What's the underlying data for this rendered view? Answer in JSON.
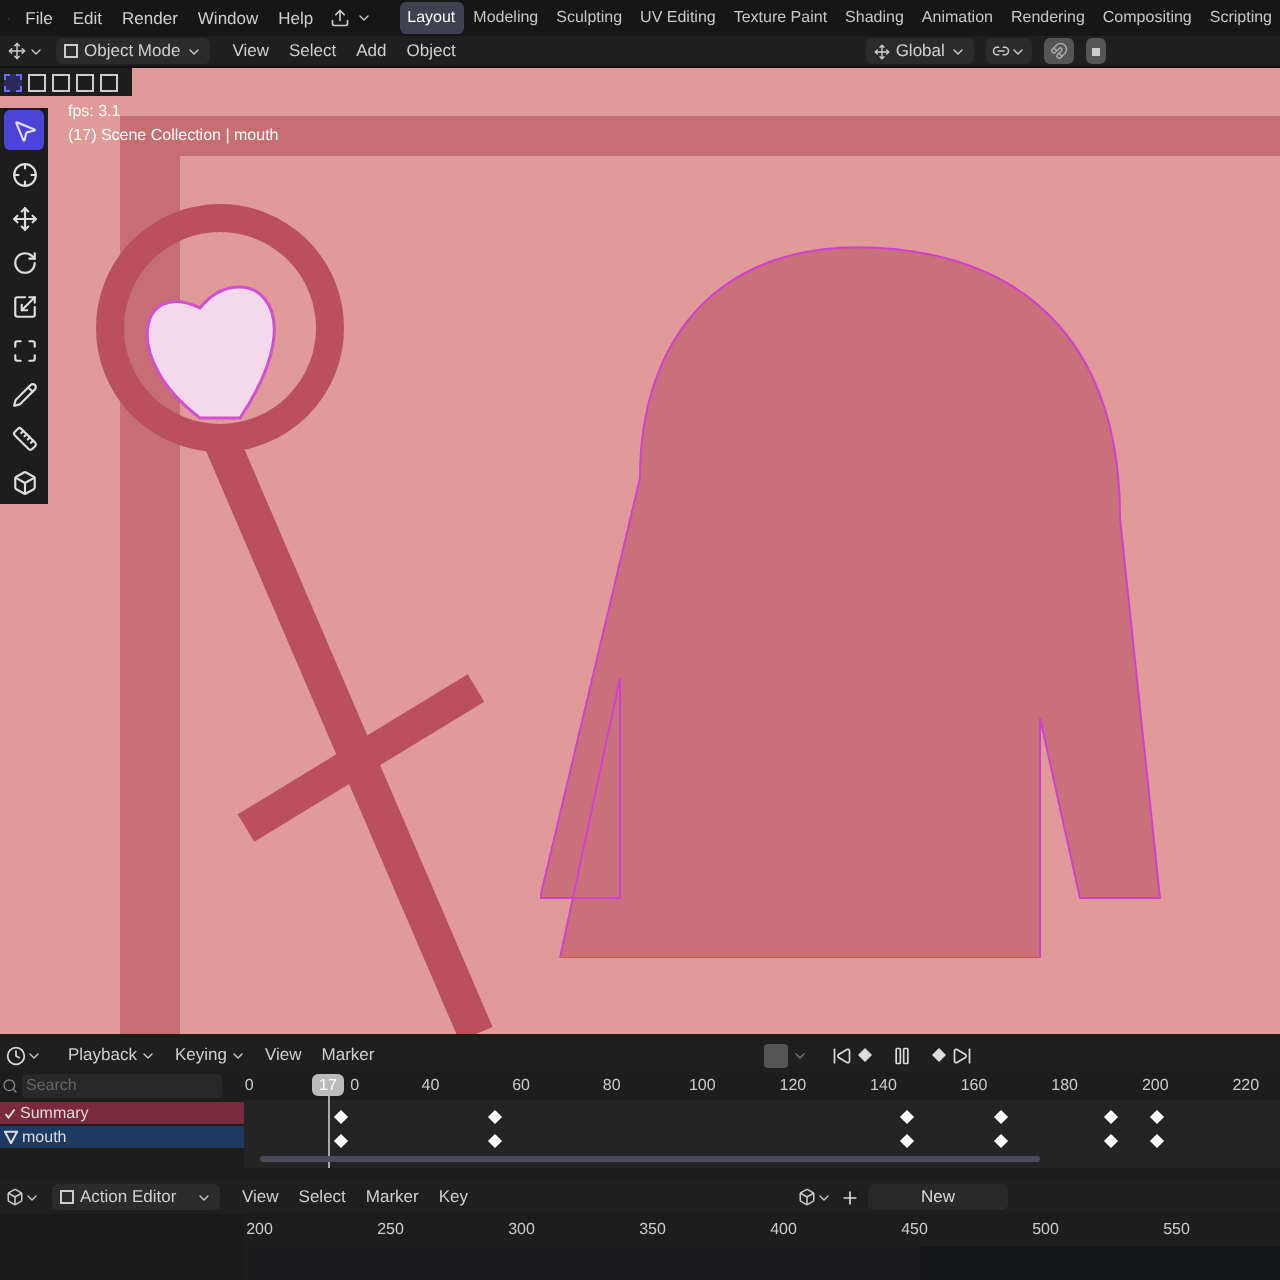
{
  "topbar": {
    "menus": [
      "File",
      "Edit",
      "Render",
      "Window",
      "Help"
    ],
    "workspaces": [
      {
        "label": "Layout",
        "selected": true
      },
      {
        "label": "Modeling",
        "selected": false
      },
      {
        "label": "Sculpting",
        "selected": false
      },
      {
        "label": "UV Editing",
        "selected": false
      },
      {
        "label": "Texture Paint",
        "selected": false
      },
      {
        "label": "Shading",
        "selected": false
      },
      {
        "label": "Animation",
        "selected": false
      },
      {
        "label": "Rendering",
        "selected": false
      },
      {
        "label": "Compositing",
        "selected": false
      },
      {
        "label": "Scripting",
        "selected": false
      }
    ]
  },
  "viewport_header": {
    "mode": "Object Mode",
    "menus": [
      "View",
      "Select",
      "Add",
      "Object"
    ],
    "orientation": "Global"
  },
  "viewport": {
    "overlay_lines": [
      "fps: 3.1",
      "(17) Scene Collection | mouth"
    ],
    "tools": [
      {
        "kind": "select",
        "selected": true
      },
      {
        "kind": "cursor",
        "selected": false
      },
      {
        "kind": "move",
        "selected": false
      },
      {
        "kind": "rotate",
        "selected": false
      },
      {
        "kind": "scale",
        "selected": false
      },
      {
        "kind": "transform",
        "selected": false
      },
      {
        "kind": "annotate",
        "selected": false
      },
      {
        "kind": "measure",
        "selected": false
      },
      {
        "kind": "add-cube",
        "selected": false
      }
    ]
  },
  "timeline": {
    "menus": [
      "Playback",
      "Keying",
      "View",
      "Marker"
    ],
    "playing": true,
    "search_placeholder": "Search",
    "current_frame": "17",
    "ruler": [
      "0",
      "0",
      "40",
      "60",
      "80",
      "100",
      "120",
      "140",
      "160",
      "180",
      "200",
      "220"
    ],
    "channels": [
      {
        "name": "Summary",
        "kind": "summary"
      },
      {
        "name": "mouth",
        "kind": "object"
      }
    ]
  },
  "action_editor": {
    "mode": "Action Editor",
    "menus": [
      "View",
      "Select",
      "Marker",
      "Key"
    ],
    "new_button": "New",
    "ruler": [
      "200",
      "250",
      "300",
      "350",
      "400",
      "450",
      "500",
      "550"
    ]
  }
}
